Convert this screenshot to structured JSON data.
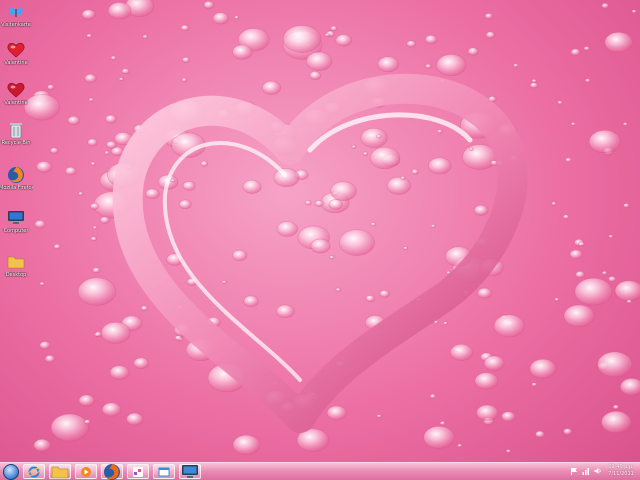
{
  "desktop": {
    "icons": [
      {
        "name": "butterfly",
        "label": "Visitenkarte",
        "icon": "butterfly-icon",
        "color": "#3da6ff"
      },
      {
        "name": "heart-app",
        "label": "Valentine",
        "icon": "heart-icon",
        "color": "#e0202f"
      },
      {
        "name": "heart-2",
        "label": "Valentine",
        "icon": "heart-icon",
        "color": "#cc1830"
      },
      {
        "name": "recycle-bin",
        "label": "Recycle Bin",
        "icon": "recycle-bin-icon",
        "color": "#d8dde4"
      },
      {
        "name": "firefox",
        "label": "Mozilla Firefox",
        "icon": "firefox-icon",
        "color": "#f08a1c"
      },
      {
        "name": "computer",
        "label": "Computer",
        "icon": "computer-icon",
        "color": "#2b7bd6"
      },
      {
        "name": "desktop-folder",
        "label": "Desktop",
        "icon": "folder-icon",
        "color": "#f2c14e"
      }
    ]
  },
  "taskbar": {
    "start_icon": "windows-start-icon",
    "pinned": [
      {
        "name": "internet-explorer",
        "icon": "ie-icon",
        "color": "#2f7fd8"
      },
      {
        "name": "windows-explorer",
        "icon": "folder-icon",
        "color": "#f2c14e"
      },
      {
        "name": "media-player",
        "icon": "media-player-icon",
        "color": "#f08a1c"
      },
      {
        "name": "firefox",
        "icon": "firefox-icon",
        "color": "#e86a1a"
      },
      {
        "name": "paint",
        "icon": "paint-icon",
        "color": "#8a5bc0"
      },
      {
        "name": "screen",
        "icon": "window-icon",
        "color": "#3d8ad6"
      },
      {
        "name": "computer",
        "icon": "computer-icon",
        "color": "#3d8ad6"
      }
    ],
    "tray": [
      {
        "name": "action-center",
        "icon": "flag-icon"
      },
      {
        "name": "network",
        "icon": "network-icon"
      },
      {
        "name": "volume",
        "icon": "volume-icon"
      }
    ],
    "clock": {
      "time": "09:40 μ.μ.",
      "date": "7/11/2011"
    }
  },
  "colors": {
    "accent": "#ec6fa4",
    "heart": "#e2588f",
    "taskbar": "#e98bb3"
  }
}
